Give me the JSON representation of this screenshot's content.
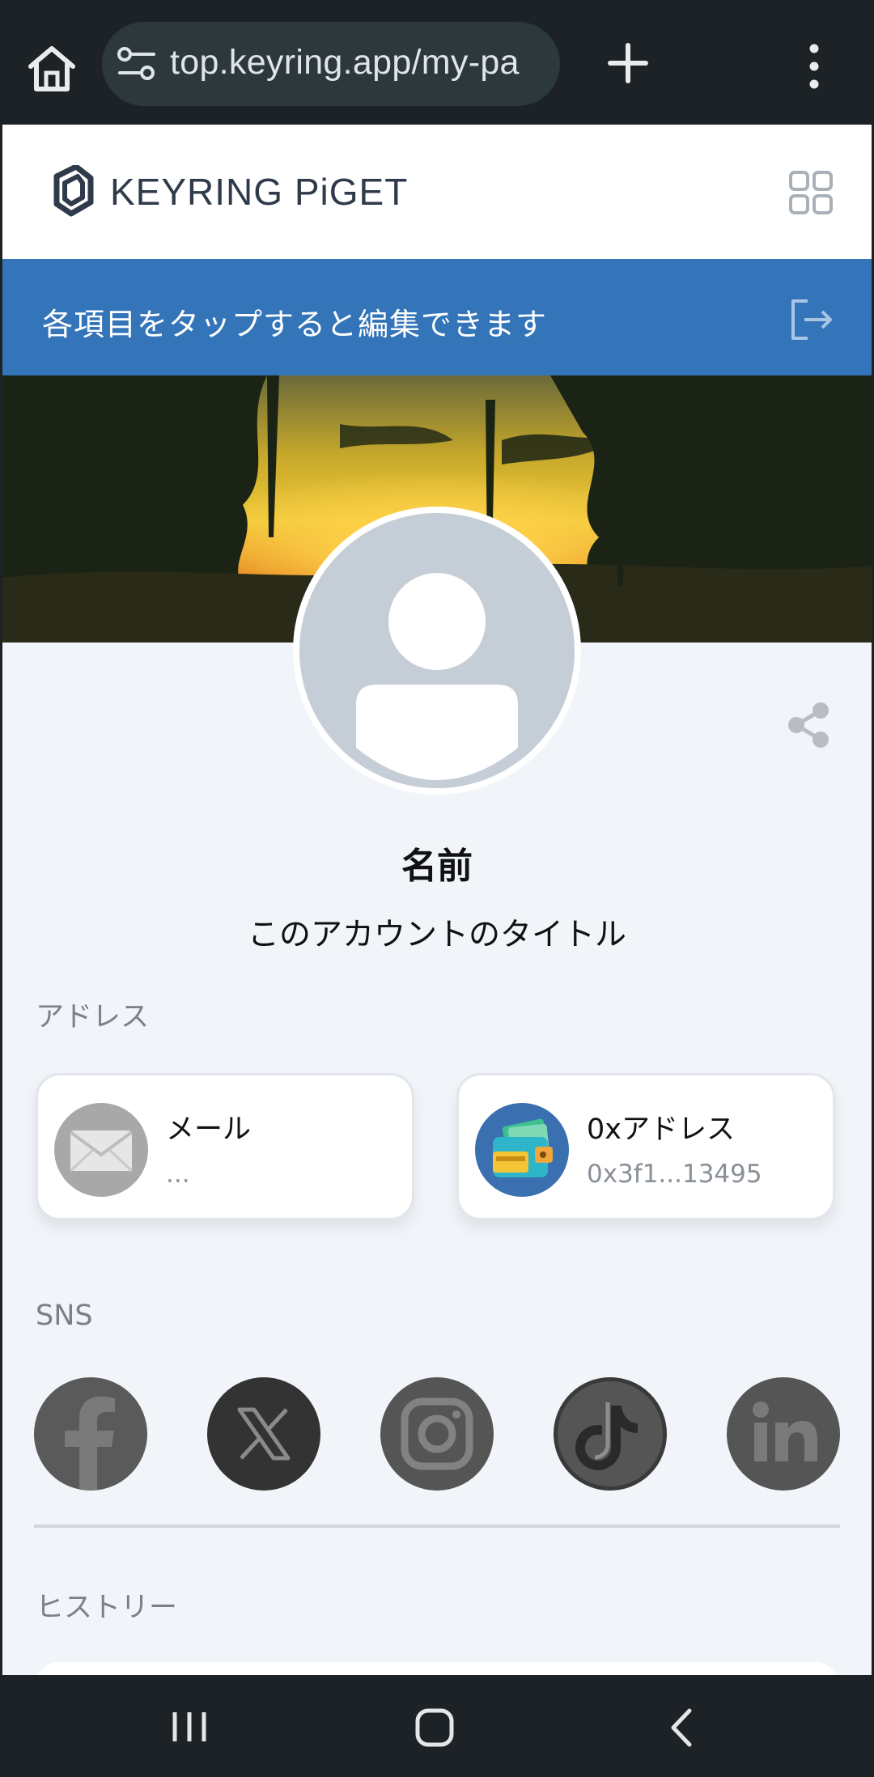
{
  "browser": {
    "url": "top.keyring.app/my-pa"
  },
  "header": {
    "brand": "KEYRING PiGET"
  },
  "banner": {
    "text": "各項目をタップすると編集できます"
  },
  "profile": {
    "name": "名前",
    "title": "このアカウントのタイトル"
  },
  "sections": {
    "address": "アドレス",
    "sns": "SNS",
    "history": "ヒストリー"
  },
  "address_cards": [
    {
      "title": "メール",
      "value": "...",
      "icon": "mail-icon"
    },
    {
      "title": "0xアドレス",
      "value": "0x3f1...13495",
      "icon": "wallet-icon"
    }
  ],
  "sns": [
    "facebook-icon",
    "x-icon",
    "instagram-icon",
    "tiktok-icon",
    "linkedin-icon"
  ],
  "colors": {
    "banner": "#3474b9",
    "page_bg": "#f1f5f9",
    "sns_bg": "#555555"
  }
}
